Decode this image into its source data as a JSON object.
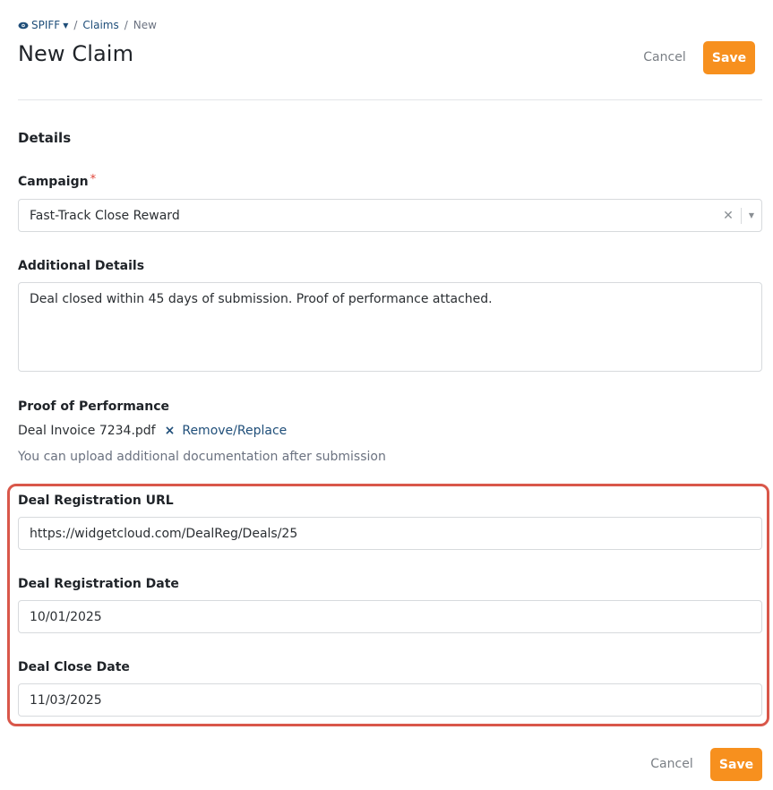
{
  "breadcrumb": {
    "brand": "SPIFF",
    "items": [
      "Claims",
      "New"
    ],
    "separator": "/"
  },
  "header": {
    "title": "New Claim",
    "cancel_label": "Cancel",
    "save_label": "Save"
  },
  "details": {
    "section_title": "Details",
    "campaign": {
      "label": "Campaign",
      "required_mark": "*",
      "value": "Fast-Track Close Reward"
    },
    "additional_details": {
      "label": "Additional Details",
      "value": "Deal closed within 45 days of submission. Proof of performance attached."
    },
    "proof": {
      "label": "Proof of Performance",
      "file_name": "Deal Invoice 7234.pdf",
      "remove_icon": "×",
      "remove_label": "Remove/Replace",
      "helper": "You can upload additional documentation after submission"
    },
    "deal_registration_url": {
      "label": "Deal Registration URL",
      "value": "https://widgetcloud.com/DealReg/Deals/25"
    },
    "deal_registration_date": {
      "label": "Deal Registration Date",
      "value": "10/01/2025"
    },
    "deal_close_date": {
      "label": "Deal Close Date",
      "value": "11/03/2025"
    }
  },
  "footer": {
    "cancel_label": "Cancel",
    "save_label": "Save"
  },
  "icons": {
    "brand": "eye-icon",
    "clear": "close-icon",
    "dropdown": "chevron-down-icon",
    "remove": "close-icon"
  },
  "colors": {
    "accent": "#f7901e",
    "link": "#1f4e79",
    "highlight": "#d9574a",
    "required": "#e0453a"
  }
}
